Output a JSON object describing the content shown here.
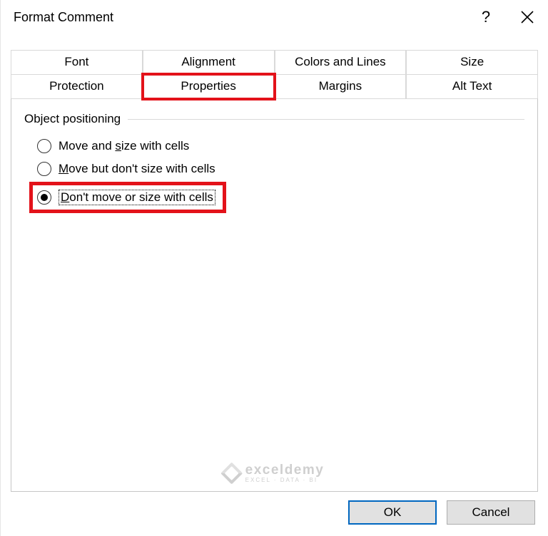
{
  "titlebar": {
    "title": "Format Comment"
  },
  "tabs": {
    "row1": [
      {
        "label": "Font"
      },
      {
        "label": "Alignment"
      },
      {
        "label": "Colors and Lines"
      },
      {
        "label": "Size"
      }
    ],
    "row2": [
      {
        "label": "Protection"
      },
      {
        "label": "Properties",
        "active": true,
        "highlighted": true
      },
      {
        "label": "Margins"
      },
      {
        "label": "Alt Text"
      }
    ]
  },
  "group": {
    "title": "Object positioning",
    "options": [
      {
        "label_pre": "Move and ",
        "mnemonic": "s",
        "label_post": "ize with cells",
        "selected": false
      },
      {
        "label_pre": "",
        "mnemonic": "M",
        "label_post": "ove but don't size with cells",
        "selected": false
      },
      {
        "label_pre": "",
        "mnemonic": "D",
        "label_post": "on't move or size with cells",
        "selected": true,
        "highlighted": true
      }
    ]
  },
  "buttons": {
    "ok": "OK",
    "cancel": "Cancel"
  },
  "watermark": {
    "brand": "exceldemy",
    "tagline": "EXCEL · DATA · BI"
  }
}
